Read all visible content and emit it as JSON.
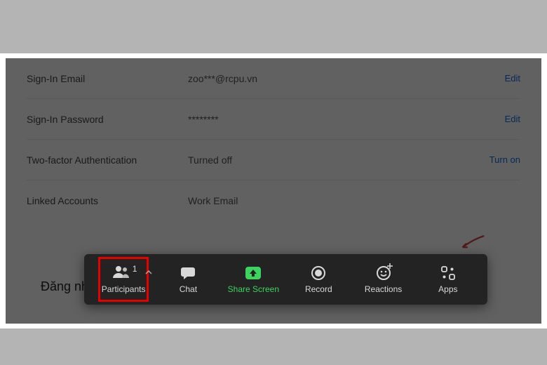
{
  "settings": {
    "rows": [
      {
        "label": "Sign-In Email",
        "value": "zoo***@rcpu.vn",
        "action": "Edit",
        "action_color": "#0e71eb"
      },
      {
        "label": "Sign-In Password",
        "value": "********",
        "action": "Edit",
        "action_color": "#0e71eb"
      },
      {
        "label": "Two-factor Authentication",
        "value": "Turned off",
        "action": "Turn on",
        "action_color": "#0e71eb"
      },
      {
        "label": "Linked Accounts",
        "value": "Work Email",
        "action": "",
        "action_color": "#0e71eb"
      }
    ]
  },
  "toolbar": {
    "participants": {
      "label": "Participants",
      "count": "1"
    },
    "chat": {
      "label": "Chat"
    },
    "share": {
      "label": "Share Screen"
    },
    "record": {
      "label": "Record"
    },
    "reactions": {
      "label": "Reactions"
    },
    "apps": {
      "label": "Apps"
    }
  },
  "caption_line1": "Đăng nhập vào lại phần mềm Zoom trên máy tính và vào lại cuộc họp.",
  "caption_line2": ""
}
